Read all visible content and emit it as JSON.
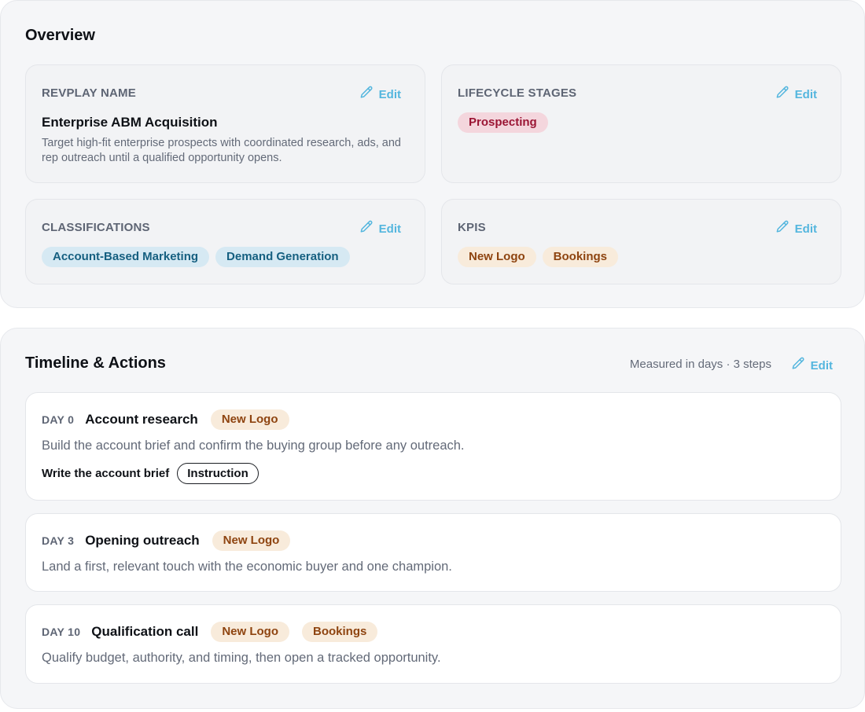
{
  "overview": {
    "title": "Overview",
    "revplay_name": {
      "label": "REVPLAY NAME",
      "edit": "Edit",
      "name": "Enterprise ABM Acquisition",
      "description": "Target high-fit enterprise prospects with coordinated research, ads, and rep outreach until a qualified opportunity opens."
    },
    "lifecycle_stages": {
      "label": "LIFECYCLE STAGES",
      "edit": "Edit",
      "chips": [
        "Prospecting"
      ]
    },
    "classifications": {
      "label": "CLASSIFICATIONS",
      "edit": "Edit",
      "chips": [
        "Account-Based Marketing",
        "Demand Generation"
      ]
    },
    "kpis": {
      "label": "KPIS",
      "edit": "Edit",
      "chips": [
        "New Logo",
        "Bookings"
      ]
    }
  },
  "timeline": {
    "title": "Timeline & Actions",
    "meta": "Measured in days · 3 steps",
    "edit": "Edit",
    "steps": [
      {
        "day": "DAY 0",
        "title": "Account research",
        "kpis": [
          "New Logo"
        ],
        "description": "Build the account brief and confirm the buying group before any outreach.",
        "action": {
          "label": "Write the account brief",
          "type": "Instruction"
        }
      },
      {
        "day": "DAY 3",
        "title": "Opening outreach",
        "kpis": [
          "New Logo"
        ],
        "description": "Land a first, relevant touch with the economic buyer and one champion."
      },
      {
        "day": "DAY 10",
        "title": "Qualification call",
        "kpis": [
          "New Logo",
          "Bookings"
        ],
        "description": "Qualify budget, authority, and timing, then open a tracked opportunity."
      }
    ]
  },
  "icons": {
    "edit": "pencil-icon"
  },
  "colors": {
    "accent": "#54b6de",
    "lifecycle_chip_bg": "#f4d6dd",
    "lifecycle_chip_text": "#9b1534",
    "classification_chip_bg": "#d6e9f3",
    "classification_chip_text": "#155f80",
    "kpi_chip_bg": "#f8ebdb",
    "kpi_chip_text": "#8e4410"
  }
}
